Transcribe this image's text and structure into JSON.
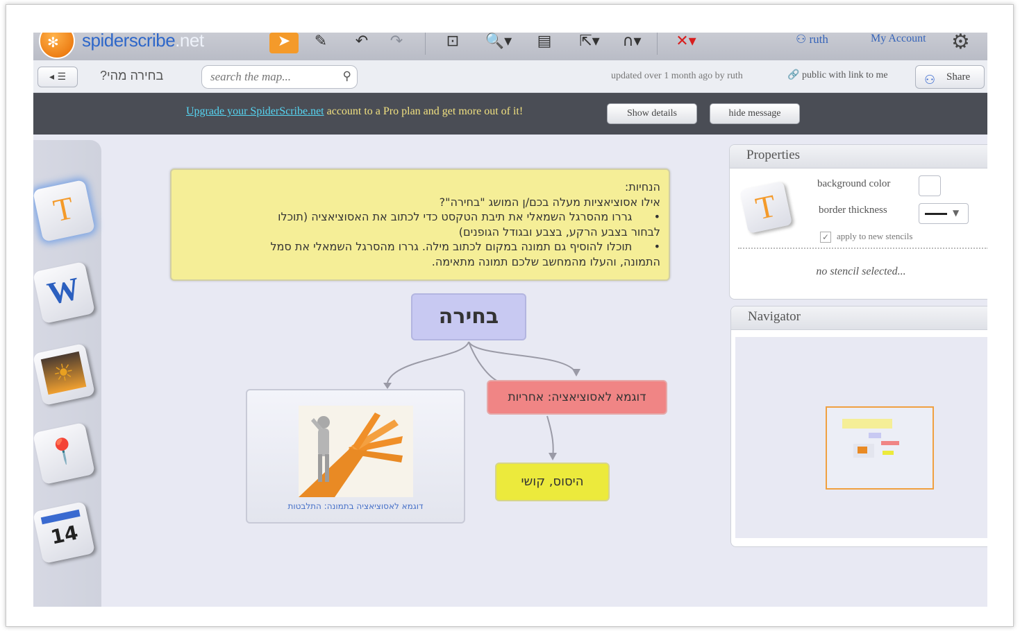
{
  "app": {
    "logo": {
      "name": "spiderscribe",
      "ext": ".net"
    },
    "user": "ruth",
    "my_account": "My Account",
    "map_title": "בחירה מהי?",
    "search_placeholder": "search the map...",
    "updated": "updated over 1 month ago by ruth",
    "public": "public with link to me",
    "share": "Share"
  },
  "banner": {
    "link": "Upgrade your SpiderScribe.net",
    "text": " account to a Pro plan and get more out of it!",
    "show_details": "Show details",
    "hide_message": "hide message"
  },
  "palette": {
    "items": [
      {
        "icon": "text-stencil-icon",
        "glyph": "T",
        "color": "#f49a2a"
      },
      {
        "icon": "document-stencil-icon",
        "glyph": "W",
        "color": "#2b5fbf"
      },
      {
        "icon": "image-stencil-icon",
        "glyph": "☀",
        "color": "#e8a020"
      },
      {
        "icon": "map-stencil-icon",
        "glyph": "📍",
        "color": "#d23030"
      },
      {
        "icon": "calendar-stencil-icon",
        "glyph": "14",
        "color": "#222222"
      }
    ]
  },
  "canvas": {
    "note_lines": [
      "הנחיות:",
      "אילו אסוציאציות מעלה בכם/ן המושג \"בחירה\"?",
      "•\tגררו מהסרגל השמאלי את תיבת הטקסט כדי לכתוב את האסוציאציה (תוכלו",
      "לבחור בצבע הרקע, בצבע ובגודל הגופנים)",
      "•\tתוכלו להוסיף גם תמונה במקום לכתוב מילה. גררו מהסרגל השמאלי את סמל",
      "התמונה, והעלו מהמחשב שלכם תמונה מתאימה."
    ],
    "central": "בחירה",
    "red_node": "דוגמא לאסוציאציה: אחריות",
    "yellow_node": "היסוס, קושי",
    "image_caption": "דוגמא לאסוציאציה בתמונה: התלבטות"
  },
  "properties": {
    "title": "Properties",
    "background_color": "background color",
    "border_thickness": "border thickness",
    "apply": "apply to new stencils",
    "empty": "no stencil selected..."
  },
  "navigator": {
    "title": "Navigator"
  }
}
